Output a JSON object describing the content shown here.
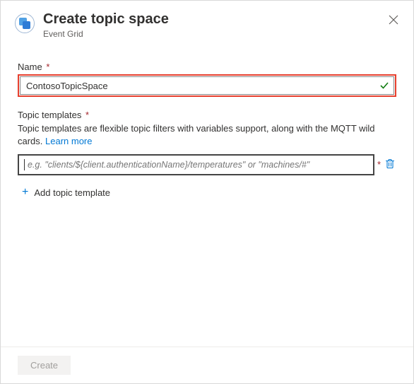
{
  "header": {
    "title": "Create topic space",
    "subtitle": "Event Grid"
  },
  "name": {
    "label": "Name",
    "required_marker": "*",
    "value": "ContosoTopicSpace"
  },
  "templates": {
    "label": "Topic templates",
    "required_marker": "*",
    "description_prefix": "Topic templates are flexible topic filters with variables support, along with the MQTT wild cards. ",
    "learn_more": "Learn more",
    "input_placeholder": "e.g. \"clients/${client.authenticationName}/temperatures\" or \"machines/#\"",
    "input_value": "",
    "row_required_marker": "*",
    "add_label": "Add topic template"
  },
  "footer": {
    "create_label": "Create"
  },
  "icons": {
    "header": "event-grid-topics-icon",
    "close": "close-icon",
    "valid": "checkmark-icon",
    "delete": "trash-icon",
    "add": "plus-icon"
  }
}
